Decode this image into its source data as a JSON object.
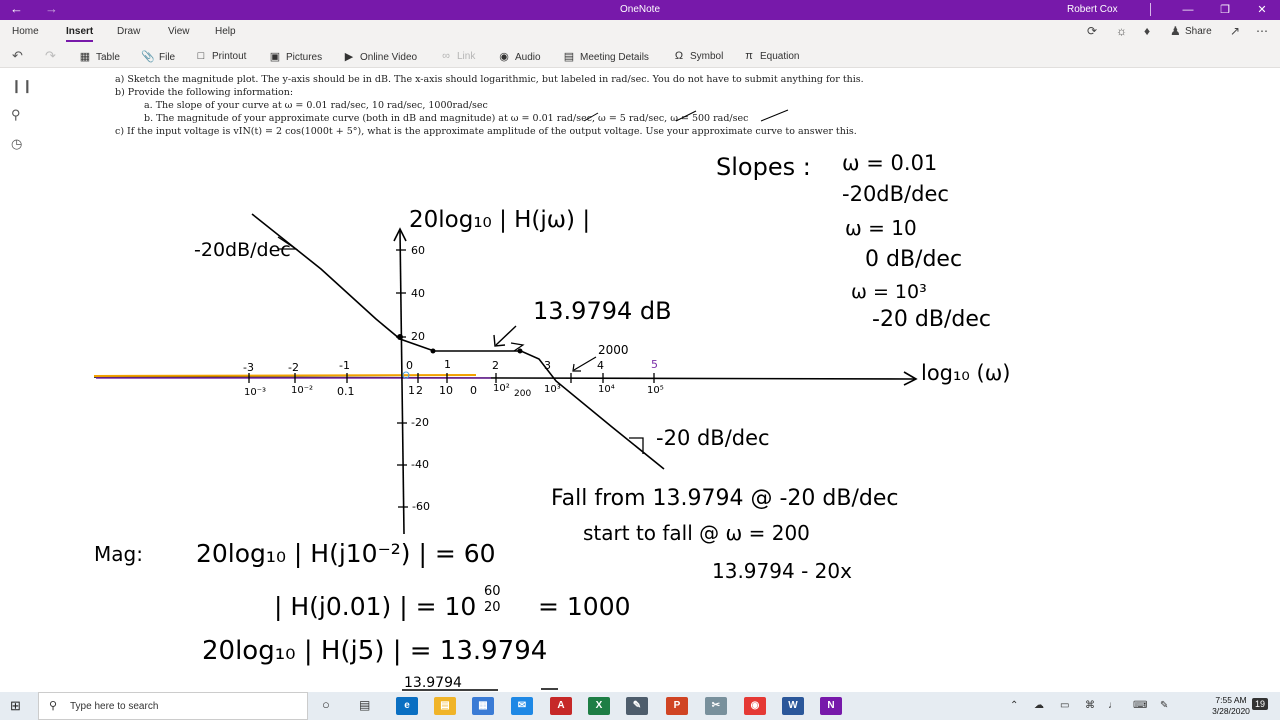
{
  "titlebar": {
    "back_icon": "back-arrow-icon",
    "forward_icon": "forward-arrow-icon",
    "app_title": "OneNote",
    "user": "Robert Cox"
  },
  "menu": {
    "tabs": [
      "Home",
      "Insert",
      "Draw",
      "View",
      "Help"
    ],
    "active_tab": "Insert",
    "share_label": "Share"
  },
  "ribbon": {
    "items": [
      {
        "label": "Table",
        "icon": "table-icon",
        "enabled": true
      },
      {
        "label": "File",
        "icon": "paperclip-icon",
        "enabled": true
      },
      {
        "label": "Printout",
        "icon": "document-icon",
        "enabled": true
      },
      {
        "label": "Pictures",
        "icon": "picture-icon",
        "enabled": true
      },
      {
        "label": "Online Video",
        "icon": "video-icon",
        "enabled": true
      },
      {
        "label": "Link",
        "icon": "link-icon",
        "enabled": false
      },
      {
        "label": "Audio",
        "icon": "microphone-icon",
        "enabled": true
      },
      {
        "label": "Meeting Details",
        "icon": "calendar-icon",
        "enabled": true
      },
      {
        "label": "Symbol",
        "icon": "omega-icon",
        "enabled": true
      },
      {
        "label": "Equation",
        "icon": "pi-icon",
        "enabled": true
      }
    ]
  },
  "page": {
    "typed_lines": [
      "a)   Sketch the magnitude plot.  The y-axis should be in dB.  The x-axis should logarithmic, but labeled in rad/sec. You do not have to submit anything for this.",
      "b)   Provide the following information:",
      "a.   The slope of your curve at ω = 0.01 rad/sec, 10 rad/sec, 1000rad/sec",
      "b.   The magnitude of your approximate curve (both in dB and magnitude) at ω = 0.01 rad/sec, ω = 5 rad/sec, ω = 500 rad/sec",
      "c)   If the input voltage is vIN(t) = 2 cos(1000t + 5°), what is the approximate amplitude of the output voltage.  Use your approximate curve to answer this."
    ],
    "ink": {
      "slopes_title": "Slopes :",
      "slope_lines": [
        "ω = 0.01",
        "-20dB/dec",
        "ω = 10",
        "0 dB/dec",
        "ω = 10³",
        "-20 dB/dec"
      ],
      "y_axis_title": "20log₁₀ | H(jω) |",
      "x_axis_title": "log₁₀ (ω)",
      "y_ticks": [
        "60",
        "40",
        "20",
        "-20",
        "-40",
        "-60"
      ],
      "x_ticks_log": [
        "-3",
        "-2",
        "-1",
        "0",
        "1",
        "2",
        "3",
        "4",
        "5"
      ],
      "x_ticks_rad": [
        "10⁻³",
        "10⁻²",
        "0.1",
        "1",
        "2",
        "10",
        "0",
        "10²",
        "200",
        "10³",
        "10⁴",
        "10⁵"
      ],
      "left_slope": "-20dB/dec",
      "plateau_label": "13.9794 dB",
      "mark_2000": "2000",
      "right_slope": "-20 dB/dec",
      "fall_line1": "Fall from 13.9794 @ -20 dB/dec",
      "fall_line2": "start to fall @ ω = 200",
      "fall_line3": "13.9794 - 20x",
      "mag_label": "Mag:",
      "mag_line1": "20log₁₀ | H(j10⁻²) |  =  60",
      "mag_line2": "| H(j0.01) |  =  10",
      "mag_frac_num": "60",
      "mag_frac_den": "20",
      "mag_line2_result": "=  1000",
      "mag_line3": "20log₁₀ | H(j5) | = 13.9794",
      "mag_line4": "13.9794"
    }
  },
  "taskbar": {
    "search_placeholder": "Type here to search",
    "time": "7:55 AM",
    "date": "3/28/2020",
    "notification_count": "19"
  }
}
